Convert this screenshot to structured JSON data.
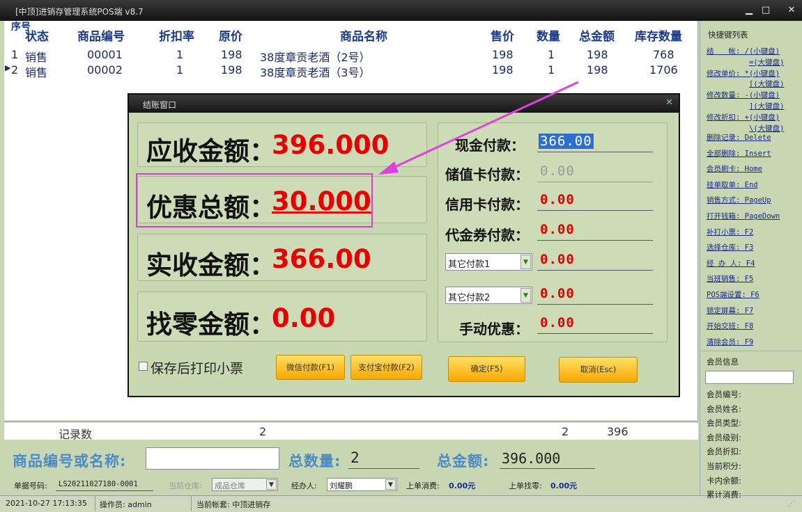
{
  "window": {
    "title": "[中顶]进销存管理系统POS端 v8.7",
    "min": "▁",
    "max": "□",
    "close": "✕"
  },
  "grid": {
    "headers": [
      "序号",
      "状态",
      "商品编号",
      "折扣率",
      "原价",
      "商品名称",
      "售价",
      "数量",
      "总金额",
      "库存数量"
    ],
    "rows": [
      {
        "seq": "1",
        "status": "销售",
        "code": "00001",
        "discount": "1",
        "orig": "198",
        "name": "38度章贡老酒（2号）",
        "price": "198",
        "qty": "1",
        "total": "198",
        "stock": "768"
      },
      {
        "seq": "2",
        "status": "销售",
        "code": "00002",
        "discount": "1",
        "orig": "198",
        "name": "38度章贡老酒（3号）",
        "price": "198",
        "qty": "1",
        "total": "198",
        "stock": "1706"
      }
    ],
    "summary": {
      "label": "记录数",
      "count": "2",
      "qty": "2",
      "total": "396"
    }
  },
  "search": {
    "label": "商品编号或名称:",
    "value": "",
    "qty_label": "总数量:",
    "qty_value": "2",
    "total_label": "总金额:",
    "total_value": "396.000"
  },
  "info": {
    "doc_label": "单据号码:",
    "doc_value": "LS20211027180-0001",
    "warehouse_label": "当前仓库:",
    "warehouse_value": "成品仓库",
    "handler_label": "经办人:",
    "handler_value": "刘耀鹏",
    "last_spend_label": "上单消费:",
    "last_spend_value": "0.00元",
    "last_change_label": "上单找零:",
    "last_change_value": "0.00元"
  },
  "status": {
    "datetime": "2021-10-27 17:13:35",
    "operator": "操作员: admin",
    "account": "当前帐套: 中顶进销存"
  },
  "shortcuts": {
    "title": "快捷键列表",
    "items": [
      "结　　帐: /(小键盘)",
      "=(大键盘)",
      "修改单价: *(小键盘)",
      "[(大键盘)",
      "修改数量: -(小键盘)",
      "](大键盘)",
      "修改折扣: +(小键盘)",
      "\\(大键盘)",
      "删除记录: Delete",
      "全部删除: Insert",
      "会员刷卡: Home",
      "挂单取单: End",
      "销售方式: PageUp",
      "打开钱箱: PageDown",
      "补打小票: F2",
      "选择仓库: F3",
      "经 办 人: F4",
      "当班销售: F5",
      "POS端设置: F6",
      "锁定屏幕: F7",
      "开始交班: F8",
      "清除会员: F9"
    ]
  },
  "member": {
    "title": "会员信息",
    "input": "",
    "fields": [
      "会员编号:",
      "会员姓名:",
      "会员类型:",
      "会员级别:",
      "会员折扣:",
      "当前积分:",
      "卡内余额:",
      "累计消费:"
    ]
  },
  "dialog": {
    "title": "结账窗口",
    "close": "✕",
    "receivable_label": "应收金额：",
    "receivable_value": "396.000",
    "discount_label": "优惠总额：",
    "discount_value": "30.000",
    "received_label": "实收金额：",
    "received_value": "366.00",
    "change_label": "找零金额：",
    "change_value": "0.00",
    "cash_label": "现金付款：",
    "cash_value": "366.00",
    "stored_label": "储值卡付款：",
    "stored_value": "0.00",
    "credit_label": "信用卡付款：",
    "credit_value": "0.00",
    "voucher_label": "代金券付款：",
    "voucher_value": "0.00",
    "other1_label": "其它付款1",
    "other1_value": "0.00",
    "other2_label": "其它付款2",
    "other2_value": "0.00",
    "manual_label": "手动优惠：",
    "manual_value": "0.00",
    "print_label": "保存后打印小票",
    "wechat_btn": "微信付款(F1)",
    "alipay_btn": "支付宝付款(F2)",
    "ok_btn": "确定(F5)",
    "cancel_btn": "取消(Esc)"
  },
  "colors": {
    "accent_red": "#e60000",
    "highlight": "#d63fd6",
    "header_blue": "#1a3a8a"
  }
}
